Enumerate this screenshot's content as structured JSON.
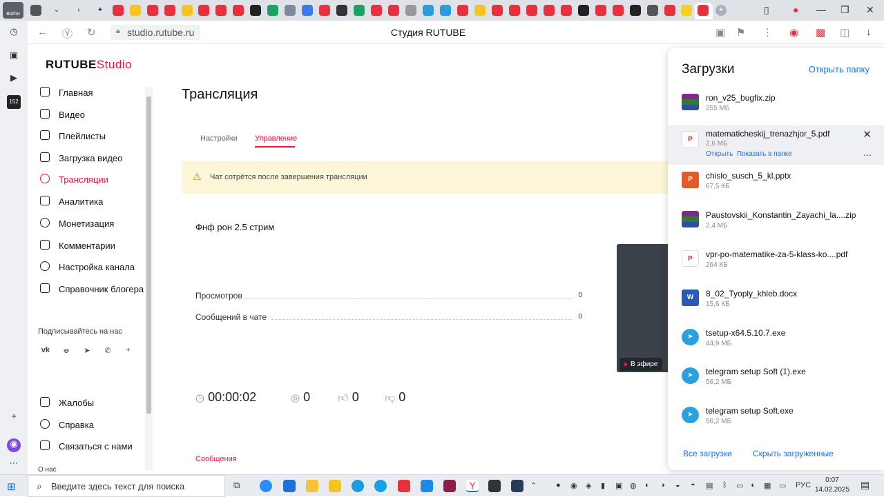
{
  "browser": {
    "login_badge": "Войти",
    "url": "studio.rutube.ru",
    "page_title": "Студия RUTUBE"
  },
  "studio": {
    "logo_main": "RUTUBE",
    "logo_studio": "Studio",
    "nav": [
      {
        "label": "Главная",
        "icon": "home-icon",
        "active": false
      },
      {
        "label": "Видео",
        "icon": "video-icon",
        "active": false
      },
      {
        "label": "Плейлисты",
        "icon": "playlist-icon",
        "active": false
      },
      {
        "label": "Загрузка видео",
        "icon": "upload-icon",
        "active": false
      },
      {
        "label": "Трансляции",
        "icon": "broadcast-icon",
        "active": true
      },
      {
        "label": "Аналитика",
        "icon": "analytics-icon",
        "active": false
      },
      {
        "label": "Монетизация",
        "icon": "monetization-icon",
        "active": false
      },
      {
        "label": "Комментарии",
        "icon": "comments-icon",
        "active": false
      },
      {
        "label": "Настройка канала",
        "icon": "gear-icon",
        "active": false
      },
      {
        "label": "Справочник блогера",
        "icon": "book-icon",
        "active": false
      }
    ],
    "subscribe_label": "Подписывайтесь на нас",
    "bottom_nav": [
      {
        "label": "Жалобы",
        "icon": "flag-icon"
      },
      {
        "label": "Справка",
        "icon": "help-icon"
      },
      {
        "label": "Связаться с нами",
        "icon": "mail-icon"
      }
    ],
    "about_label": "О нас"
  },
  "main": {
    "title": "Трансляция",
    "tabs": [
      {
        "label": "Настройки",
        "active": false
      },
      {
        "label": "Управление",
        "active": true
      }
    ],
    "warning": "Чат сотрётся после завершения трансляции",
    "stream": {
      "title": "Фнф рон 2.5 стрим",
      "stats": [
        {
          "label": "Просмотров",
          "value": "0"
        },
        {
          "label": "Сообщений в чате",
          "value": "0"
        }
      ],
      "live_badge": "В эфире",
      "duration": "00:00:02",
      "viewers": "0",
      "likes": "0",
      "dislikes": "0"
    },
    "messages_label": "Сообщения"
  },
  "downloads": {
    "title": "Загрузки",
    "open_folder": "Открыть папку",
    "open_action": "Открыть",
    "show_in_folder_action": "Показать в папке",
    "items": [
      {
        "name": "ron_v25_bugfix.zip",
        "size": "255 МБ",
        "type": "zip"
      },
      {
        "name": "matematicheskij_trenazhjor_5.pdf",
        "size": "2,6 МБ",
        "type": "pdf"
      },
      {
        "name": "chislo_susch_5_kl.pptx",
        "size": "67,5 КБ",
        "type": "ppt"
      },
      {
        "name": "Paustovskii_Konstantin_Zayachi_la....zip",
        "size": "2,4 МБ",
        "type": "zip"
      },
      {
        "name": "vpr-po-matematike-za-5-klass-ko....pdf",
        "size": "264 КБ",
        "type": "pdf"
      },
      {
        "name": "8_02_Tyoply_khleb.docx",
        "size": "15,6 КБ",
        "type": "doc"
      },
      {
        "name": "tsetup-x64.5.10.7.exe",
        "size": "44,9 МБ",
        "type": "tg"
      },
      {
        "name": "telegram setup Soft (1).exe",
        "size": "56,2 МБ",
        "type": "tg"
      },
      {
        "name": "telegram setup Soft.exe",
        "size": "56,2 МБ",
        "type": "tg"
      }
    ],
    "all_downloads": "Все загрузки",
    "hide_downloaded": "Скрыть загруженные"
  },
  "taskbar": {
    "search_placeholder": "Введите здесь текст для поиска",
    "language": "РУС",
    "time": "0:07",
    "date": "14.02.2025"
  }
}
